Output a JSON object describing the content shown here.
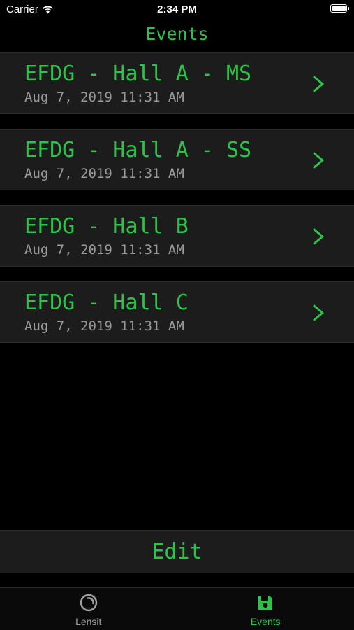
{
  "status_bar": {
    "carrier": "Carrier",
    "time": "2:34 PM",
    "wifi_icon": "wifi-icon",
    "battery_icon": "battery-icon"
  },
  "nav": {
    "title": "Events"
  },
  "events": [
    {
      "title": "EFDG - Hall A - MS",
      "date": "Aug 7, 2019 11:31 AM"
    },
    {
      "title": "EFDG - Hall A - SS",
      "date": "Aug 7, 2019 11:31 AM"
    },
    {
      "title": "EFDG - Hall B",
      "date": "Aug 7, 2019 11:31 AM"
    },
    {
      "title": "EFDG - Hall C",
      "date": "Aug 7, 2019 11:31 AM"
    }
  ],
  "edit_label": "Edit",
  "tabs": [
    {
      "label": "Lensit",
      "icon": "lens-icon",
      "active": false
    },
    {
      "label": "Events",
      "icon": "floppy-disk-icon",
      "active": true
    }
  ],
  "colors": {
    "accent": "#2ec24a",
    "background": "#000000",
    "row_background": "#1c1c1c",
    "secondary_text": "#9a9a9a"
  }
}
